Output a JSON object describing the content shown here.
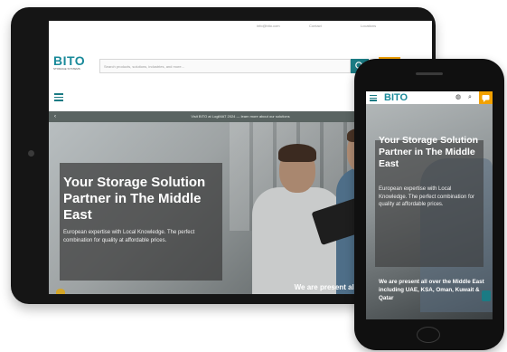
{
  "brand": {
    "logo": "BITO",
    "logo_sub": "STORAGE SYSTEMS",
    "teal": "#1b7b84",
    "accent": "#f2a100"
  },
  "tablet": {
    "topbar": [
      "info@bito.com",
      "Contact",
      "Locations"
    ],
    "search_placeholder": "Search products, solutions, industries, and more...",
    "announcement": "Visit BITO at LogiMAT 2024 — learn more about our solutions",
    "hero": {
      "title": "Your Storage Solution Partner in The Middle East",
      "subtitle": "European expertise with Local Knowledge. The perfect combination for quality at affordable prices.",
      "caption": "We are present all over the Middle East"
    }
  },
  "phone": {
    "hero": {
      "title": "Your Storage Solution Partner in The Middle East",
      "subtitle": "European expertise with Local Knowledge. The perfect combination for quality at affordable prices.",
      "caption": "We are present all over the Middle East including UAE, KSA, Oman, Kuwait & Qatar"
    }
  }
}
